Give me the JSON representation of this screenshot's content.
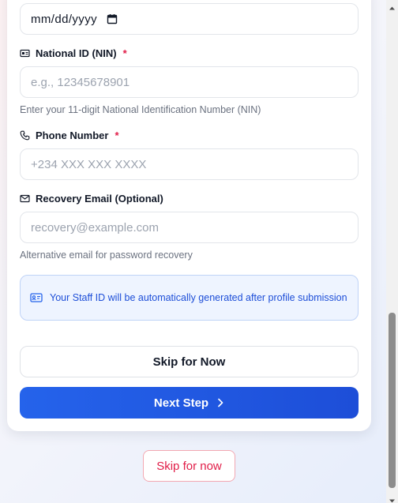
{
  "form": {
    "date_field": {
      "value": "mm/dd/yyyy"
    },
    "nin": {
      "label": "National ID (NIN)",
      "required_marker": "*",
      "placeholder": "e.g., 12345678901",
      "hint": "Enter your 11-digit National Identification Number (NIN)"
    },
    "phone": {
      "label": "Phone Number",
      "required_marker": "*",
      "placeholder": "+234 XXX XXX XXXX"
    },
    "recovery_email": {
      "label": "Recovery Email (Optional)",
      "placeholder": "recovery@example.com",
      "hint": "Alternative email for password recovery"
    },
    "info_notice": "Your Staff ID will be automatically generated after profile submission",
    "skip_button": "Skip for Now",
    "next_button": "Next Step"
  },
  "footer": {
    "skip_link": "Skip for now"
  },
  "colors": {
    "accent": "#2563eb",
    "required": "#e11d48",
    "info_bg": "#eef4ff",
    "info_text": "#1d4ed8"
  },
  "icons": [
    "calendar-icon",
    "id-card-icon",
    "phone-icon",
    "mail-icon",
    "badge-icon",
    "chevron-right-icon"
  ]
}
